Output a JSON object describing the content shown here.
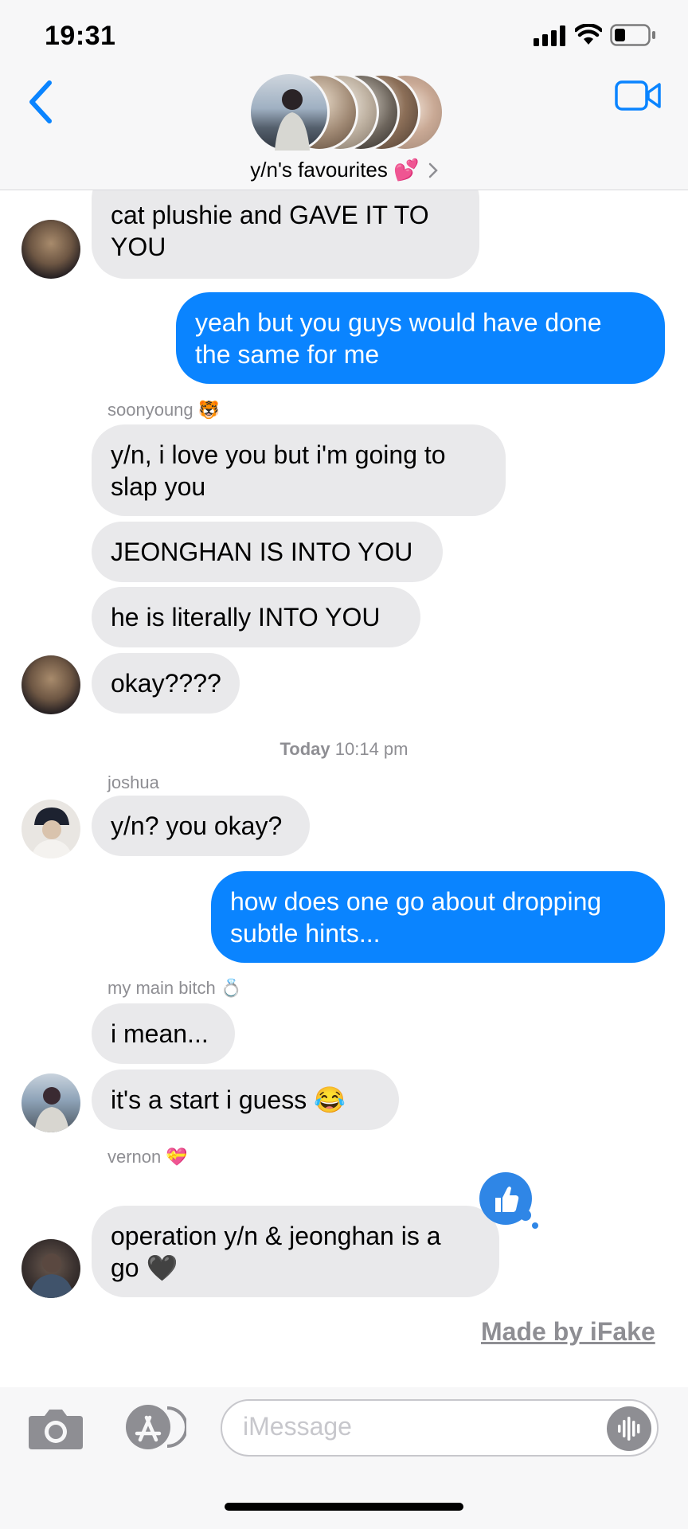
{
  "status_bar": {
    "time": "19:31"
  },
  "header": {
    "group_name": "y/n's favourites",
    "group_emoji": "💕"
  },
  "messages": {
    "m1": {
      "lines": [
        "cat plushie and GAVE IT TO",
        "YOU"
      ]
    },
    "m2": {
      "lines": [
        "yeah but you guys would have done",
        "the same for me"
      ]
    },
    "sender_soonyoung": {
      "name": "soonyoung",
      "emoji": "🐯"
    },
    "m3": {
      "lines": [
        "y/n, i love you but i'm going to",
        "slap you"
      ]
    },
    "m4": {
      "text": "JEONGHAN IS INTO YOU"
    },
    "m5": {
      "text": "he is literally INTO YOU"
    },
    "m6": {
      "text": "okay????"
    },
    "timestamp": {
      "day": "Today",
      "time": "10:14 pm"
    },
    "sender_joshua": {
      "name": "joshua"
    },
    "m7": {
      "text": "y/n? you okay?"
    },
    "m8": {
      "lines": [
        "how does one go about dropping",
        "subtle hints..."
      ]
    },
    "sender_main": {
      "name": "my main bitch",
      "emoji": "💍"
    },
    "m9": {
      "text": "i mean..."
    },
    "m10": {
      "text": "it's a start i guess 😂"
    },
    "sender_vernon": {
      "name": "vernon",
      "emoji": "💝"
    },
    "m11": {
      "lines": [
        "operation y/n & jeonghan is a",
        "go 🖤"
      ]
    }
  },
  "watermark": "Made by iFake",
  "input": {
    "placeholder": "iMessage"
  },
  "icons": [
    "back-chevron-icon",
    "video-camera-icon",
    "camera-icon",
    "app-store-icon",
    "audio-waveform-icon",
    "thumbs-up-icon"
  ],
  "colors": {
    "accent": "#0a84ff",
    "received_bubble": "#e9e9eb",
    "sent_bubble": "#0a84ff"
  }
}
